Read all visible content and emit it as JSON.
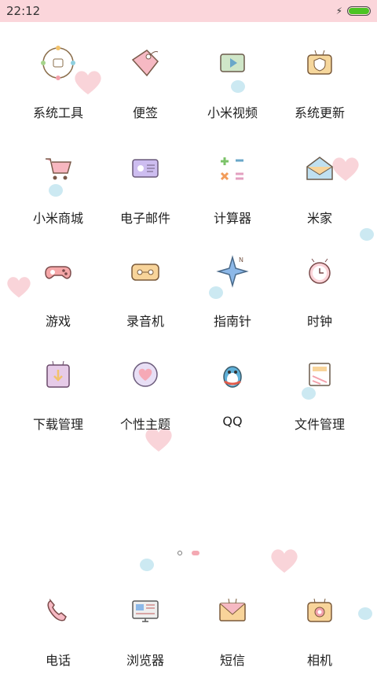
{
  "status": {
    "time": "22:12",
    "battery_level": 1.0
  },
  "apps": [
    {
      "label": "系统工具",
      "icon": "tools-circle-icon"
    },
    {
      "label": "便签",
      "icon": "tag-icon"
    },
    {
      "label": "小米视频",
      "icon": "video-player-icon"
    },
    {
      "label": "系统更新",
      "icon": "update-shield-icon"
    },
    {
      "label": "小米商城",
      "icon": "shopping-cart-icon"
    },
    {
      "label": "电子邮件",
      "icon": "email-card-icon"
    },
    {
      "label": "计算器",
      "icon": "calculator-symbols-icon"
    },
    {
      "label": "米家",
      "icon": "home-envelope-icon"
    },
    {
      "label": "游戏",
      "icon": "gamepad-icon"
    },
    {
      "label": "录音机",
      "icon": "cassette-recorder-icon"
    },
    {
      "label": "指南针",
      "icon": "compass-star-icon"
    },
    {
      "label": "时钟",
      "icon": "alarm-clock-icon"
    },
    {
      "label": "下载管理",
      "icon": "download-box-icon"
    },
    {
      "label": "个性主题",
      "icon": "heart-theme-icon"
    },
    {
      "label": "QQ",
      "icon": "qq-penguin-icon"
    },
    {
      "label": "文件管理",
      "icon": "file-folder-icon"
    }
  ],
  "dock": [
    {
      "label": "电话",
      "icon": "phone-icon"
    },
    {
      "label": "浏览器",
      "icon": "browser-monitor-icon"
    },
    {
      "label": "短信",
      "icon": "sms-envelope-icon"
    },
    {
      "label": "相机",
      "icon": "camera-icon"
    }
  ],
  "page_indicator": {
    "count": 2,
    "current": 2
  }
}
